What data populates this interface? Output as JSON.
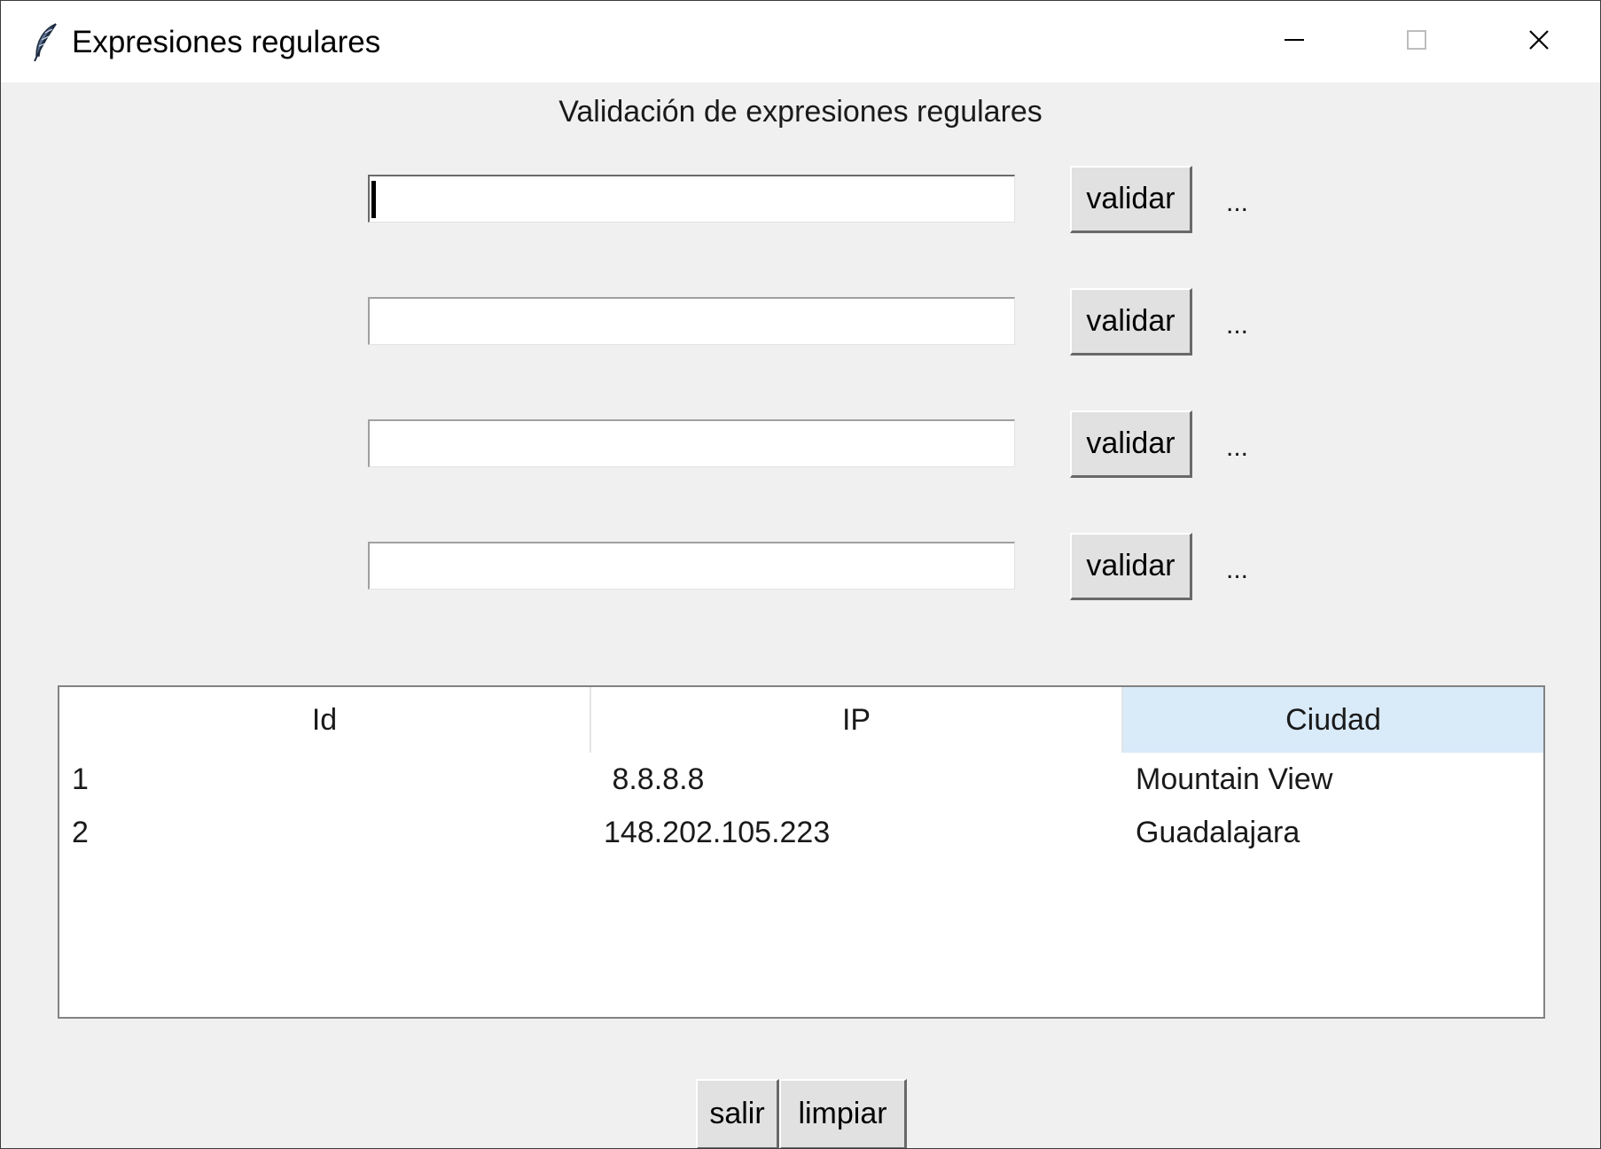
{
  "window": {
    "title": "Expresiones regulares",
    "close_glyph": "✕"
  },
  "heading": "Validación de expresiones regulares",
  "fields": [
    {
      "value": "",
      "button_label": "validar",
      "result": "..."
    },
    {
      "value": "",
      "button_label": "validar",
      "result": "..."
    },
    {
      "value": "",
      "button_label": "validar",
      "result": "..."
    },
    {
      "value": "",
      "button_label": "validar",
      "result": "..."
    }
  ],
  "table": {
    "columns": [
      "Id",
      "IP",
      "Ciudad"
    ],
    "sorted_column": "Ciudad",
    "rows": [
      {
        "id": "1",
        "ip": " 8.8.8.8",
        "ciudad": "Mountain View"
      },
      {
        "id": "2",
        "ip": "148.202.105.223",
        "ciudad": "Guadalajara"
      }
    ]
  },
  "buttons": {
    "salir": "salir",
    "limpiar": "limpiar"
  },
  "icons": {
    "app": "feather-icon",
    "minimize": "minimize-icon",
    "maximize": "maximize-icon",
    "close": "close-icon"
  },
  "colors": {
    "window_bg": "#f0f0f0",
    "button_bg": "#e1e1e1",
    "header_highlight": "#d9eaf9"
  }
}
